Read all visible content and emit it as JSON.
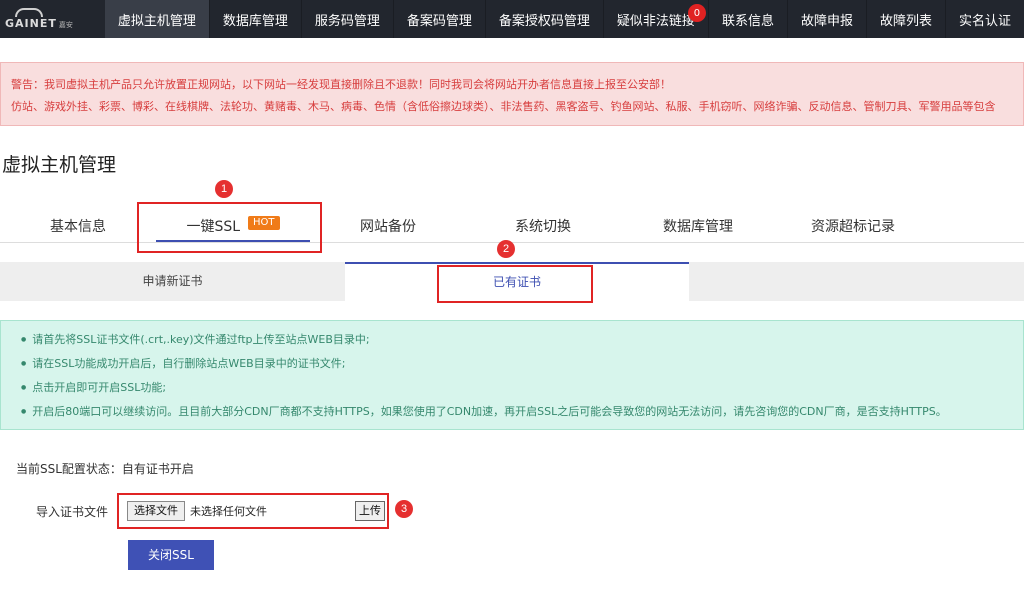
{
  "logo": {
    "text": "GAINET",
    "small": "嘉安"
  },
  "nav": [
    {
      "label": "虚拟主机管理",
      "active": true
    },
    {
      "label": "数据库管理"
    },
    {
      "label": "服务码管理"
    },
    {
      "label": "备案码管理"
    },
    {
      "label": "备案授权码管理"
    },
    {
      "label": "疑似非法链接",
      "badge": "0"
    },
    {
      "label": "联系信息"
    },
    {
      "label": "故障申报"
    },
    {
      "label": "故障列表"
    },
    {
      "label": "实名认证"
    }
  ],
  "warning": {
    "line1": "警告：我司虚拟主机产品只允许放置正规网站，以下网站一经发现直接删除且不退款！同时我司会将网站开办者信息直接上报至公安部！",
    "line2": "仿站、游戏外挂、彩票、博彩、在线棋牌、法轮功、黄赌毒、木马、病毒、色情（含低俗擦边球类）、非法售药、黑客盗号、钓鱼网站、私服、手机窃听、网络诈骗、反动信息、管制刀具、军警用品等包含"
  },
  "page_title": "虚拟主机管理",
  "tabs": [
    {
      "label": "基本信息"
    },
    {
      "label": "一键SSL",
      "badge": "HOT",
      "active": true
    },
    {
      "label": "网站备份"
    },
    {
      "label": "系统切换"
    },
    {
      "label": "数据库管理"
    },
    {
      "label": "资源超标记录"
    }
  ],
  "subtabs": [
    {
      "label": "申请新证书"
    },
    {
      "label": "已有证书",
      "active": true
    }
  ],
  "info": [
    "请首先将SSL证书文件(.crt,.key)文件通过ftp上传至站点WEB目录中;",
    "请在SSL功能成功开启后，自行删除站点WEB目录中的证书文件;",
    "点击开启即可开启SSL功能;",
    "开启后80端口可以继续访问。且目前大部分CDN厂商都不支持HTTPS，如果您使用了CDN加速，再开启SSL之后可能会导致您的网站无法访问，请先咨询您的CDN厂商，是否支持HTTPS。"
  ],
  "ssl_status": {
    "label": "当前SSL配置状态：",
    "value": "自有证书开启"
  },
  "import": {
    "label": "导入证书文件",
    "choose_button": "选择文件",
    "no_file_text": "未选择任何文件",
    "upload_button": "上传"
  },
  "close_button": "关闭SSL",
  "callouts": [
    "1",
    "2",
    "3"
  ],
  "colors": {
    "nav_bg": "#22262e",
    "accent": "#3f51b5",
    "hot": "#f07b18",
    "warning_text": "#d73d3d",
    "info_text": "#35886d",
    "annotation": "#e02424"
  }
}
